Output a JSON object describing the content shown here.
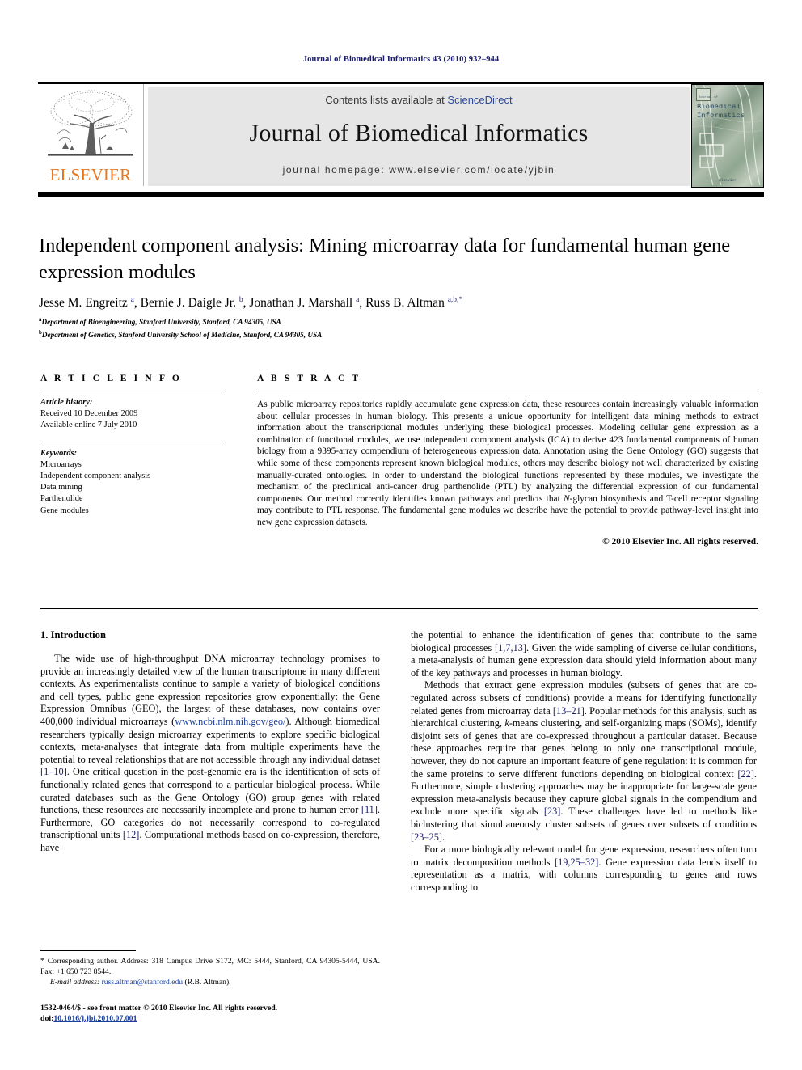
{
  "running_head": "Journal of Biomedical Informatics 43 (2010) 932–944",
  "masthead": {
    "publisher_name": "ELSEVIER",
    "contents_prefix": "Contents lists available at ",
    "contents_link": "ScienceDirect",
    "journal_name": "Journal of Biomedical Informatics",
    "homepage_line": "journal homepage: www.elsevier.com/locate/yjbin",
    "cover": {
      "kicker": "Journal of",
      "line1": "Biomedical",
      "line2": "Informatics",
      "footer": "Elsevier"
    }
  },
  "article": {
    "title": "Independent component analysis: Mining microarray data for fundamental human gene expression modules",
    "authors_html": "Jesse M. Engreitz <sup>a</sup>, Bernie J. Daigle Jr. <sup>b</sup>, Jonathan J. Marshall <sup>a</sup>, Russ B. Altman <sup>a,b,</sup><sup>*</sup>",
    "affiliations": [
      {
        "marker": "a",
        "text": "Department of Bioengineering, Stanford University, Stanford, CA 94305, USA"
      },
      {
        "marker": "b",
        "text": "Department of Genetics, Stanford University School of Medicine, Stanford, CA 94305, USA"
      }
    ]
  },
  "article_info": {
    "heading": "A R T I C L E  I N F O",
    "history_label": "Article history:",
    "history": [
      "Received 10 December 2009",
      "Available online 7 July 2010"
    ],
    "keywords_label": "Keywords:",
    "keywords": [
      "Microarrays",
      "Independent component analysis",
      "Data mining",
      "Parthenolide",
      "Gene modules"
    ]
  },
  "abstract": {
    "heading": "A B S T R A C T",
    "text": "As public microarray repositories rapidly accumulate gene expression data, these resources contain increasingly valuable information about cellular processes in human biology. This presents a unique opportunity for intelligent data mining methods to extract information about the transcriptional modules underlying these biological processes. Modeling cellular gene expression as a combination of functional modules, we use independent component analysis (ICA) to derive 423 fundamental components of human biology from a 9395-array compendium of heterogeneous expression data. Annotation using the Gene Ontology (GO) suggests that while some of these components represent known biological modules, others may describe biology not well characterized by existing manually-curated ontologies. In order to understand the biological functions represented by these modules, we investigate the mechanism of the preclinical anti-cancer drug parthenolide (PTL) by analyzing the differential expression of our fundamental components. Our method correctly identifies known pathways and predicts that N-glycan biosynthesis and T-cell receptor signaling may contribute to PTL response. The fundamental gene modules we describe have the potential to provide pathway-level insight into new gene expression datasets.",
    "copyright": "© 2010 Elsevier Inc. All rights reserved."
  },
  "introduction": {
    "heading": "1. Introduction",
    "left_paragraph_1": "The wide use of high-throughput DNA microarray technology promises to provide an increasingly detailed view of the human transcriptome in many different contexts. As experimentalists continue to sample a variety of biological conditions and cell types, public gene expression repositories grow exponentially: the Gene Expression Omnibus (GEO), the largest of these databases, now contains over 400,000 individual microarrays (www.ncbi.nlm.nih.gov/geo/). Although biomedical researchers typically design microarray experiments to explore specific biological contexts, meta-analyses that integrate data from multiple experiments have the potential to reveal relationships that are not accessible through any individual dataset [1–10]. One critical question in the post-genomic era is the identification of sets of functionally related genes that correspond to a particular biological process. While curated databases such as the Gene Ontology (GO) group genes with related functions, these resources are necessarily incomplete and prone to human error [11]. Furthermore, GO categories do not necessarily correspond to co-regulated transcriptional units [12]. Computational methods based on co-expression, therefore, have",
    "right_paragraph_1_cont": "the potential to enhance the identification of genes that contribute to the same biological processes [1,7,13]. Given the wide sampling of diverse cellular conditions, a meta-analysis of human gene expression data should yield information about many of the key pathways and processes in human biology.",
    "right_paragraph_2": "Methods that extract gene expression modules (subsets of genes that are co-regulated across subsets of conditions) provide a means for identifying functionally related genes from microarray data [13–21]. Popular methods for this analysis, such as hierarchical clustering, k-means clustering, and self-organizing maps (SOMs), identify disjoint sets of genes that are co-expressed throughout a particular dataset. Because these approaches require that genes belong to only one transcriptional module, however, they do not capture an important feature of gene regulation: it is common for the same proteins to serve different functions depending on biological context [22]. Furthermore, simple clustering approaches may be inappropriate for large-scale gene expression meta-analysis because they capture global signals in the compendium and exclude more specific signals [23]. These challenges have led to methods like biclustering that simultaneously cluster subsets of genes over subsets of conditions [23–25].",
    "right_paragraph_3": "For a more biologically relevant model for gene expression, researchers often turn to matrix decomposition methods [19,25–32]. Gene expression data lends itself to representation as a matrix, with columns corresponding to genes and rows corresponding to"
  },
  "footnote": {
    "star": "*",
    "corresponding": "Corresponding author. Address: 318 Campus Drive S172, MC: 5444, Stanford, CA 94305-5444, USA. Fax: +1 650 723 8544.",
    "email_label": "E-mail address:",
    "email": "russ.altman@stanford.edu",
    "email_suffix": "(R.B. Altman)."
  },
  "footer": {
    "issn_line": "1532-0464/$ - see front matter © 2010 Elsevier Inc. All rights reserved.",
    "doi_label": "doi:",
    "doi_value": "10.1016/j.jbi.2010.07.001"
  },
  "colors": {
    "running_head": "#1a1a6e",
    "link": "#2b4a9b",
    "elsevier_orange": "#e87722",
    "reference": "#1a1a6e",
    "band_bg": "#e6e6e6"
  }
}
